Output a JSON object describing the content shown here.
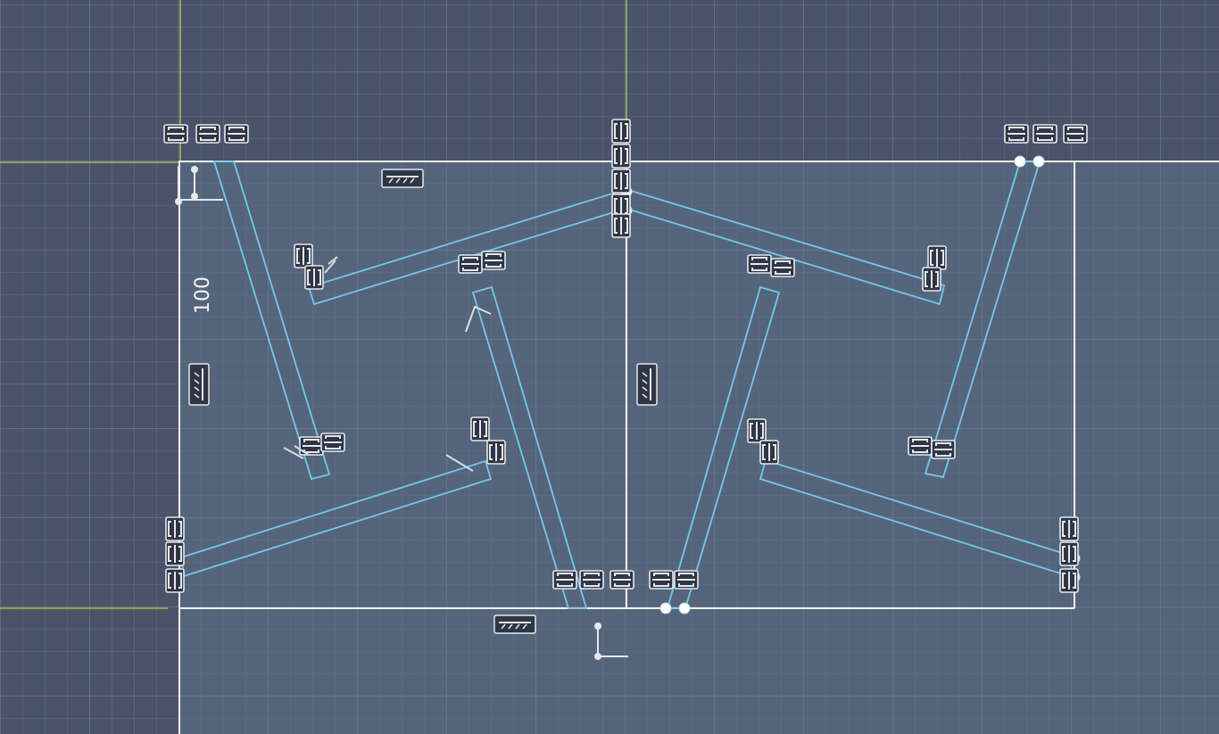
{
  "colors": {
    "background": "#4b536a",
    "canvas_shade": "#53647a",
    "grid_line": "#677488",
    "axis_line": "#9fbf45",
    "sketch_white": "#f2f4f7",
    "sketch_blue": "#74c7ee",
    "constraint_bg": "#2f3645",
    "constraint_stroke": "#e6e8ee"
  },
  "icons": [
    "coincident-constraint-icon",
    "horizontal-constraint-icon",
    "vertical-constraint-icon",
    "parallel-constraint-icon",
    "perpendicular-constraint-icon",
    "tangent-constraint-icon",
    "fix-point-icon",
    "sketch-point-icon"
  ],
  "sketch": {
    "dimension_label": "100"
  }
}
